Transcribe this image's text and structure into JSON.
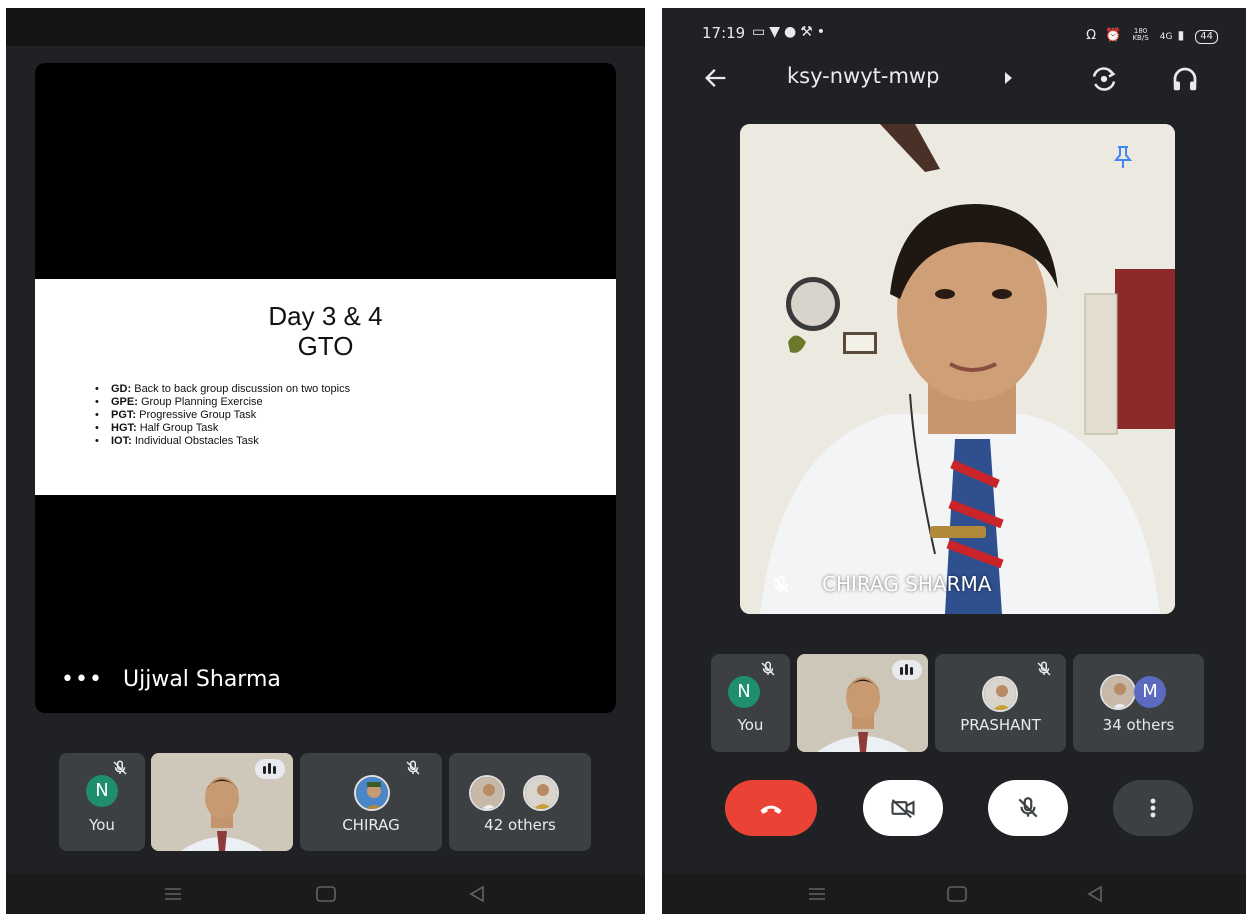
{
  "left": {
    "slide": {
      "title_line1": "Day 3 & 4",
      "title_line2": "GTO",
      "bullets": [
        {
          "key": "GD:",
          "text": " Back to back group discussion on two topics"
        },
        {
          "key": "GPE:",
          "text": " Group Planning Exercise"
        },
        {
          "key": "PGT:",
          "text": " Progressive Group Task"
        },
        {
          "key": "HGT:",
          "text": " Half Group Task"
        },
        {
          "key": "IOT:",
          "text": " Individual Obstacles Task"
        }
      ]
    },
    "presenter": {
      "dots": "•••",
      "name": "Ujjwal Sharma"
    },
    "tiles": {
      "you": {
        "avatar_letter": "N",
        "label": "You"
      },
      "chirag": {
        "label": "CHIRAG"
      },
      "others": {
        "label": "42 others"
      }
    }
  },
  "right": {
    "status": {
      "time": "17:19",
      "speed_top": "180",
      "speed_bottom": "KB/S",
      "network": "4G",
      "battery": "44"
    },
    "header": {
      "meeting_code": "ksy-nwyt-mwp"
    },
    "main_video": {
      "name": "CHIRAG SHARMA"
    },
    "tiles": {
      "you": {
        "avatar_letter": "N",
        "label": "You"
      },
      "prashant": {
        "label": "PRASHANT"
      },
      "others": {
        "avatar_letter": "M",
        "label": "34 others"
      }
    }
  },
  "colors": {
    "background": "#202124",
    "tile": "#3c4043",
    "end_call": "#ea4335",
    "avatar_n": "#1e8e6e",
    "avatar_m": "#5c6bc0"
  },
  "icons": [
    "mic-off-icon",
    "pin-icon",
    "switch-camera-icon",
    "headphones-icon",
    "back-arrow-icon",
    "end-call-icon",
    "camera-off-icon",
    "more-options-icon",
    "menu-icon",
    "home-icon",
    "back-nav-icon"
  ]
}
